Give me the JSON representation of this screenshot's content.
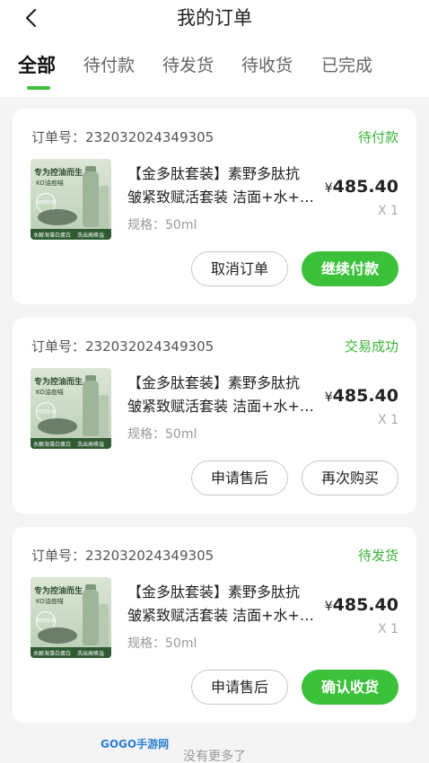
{
  "header": {
    "title": "我的订单",
    "back_icon": "chevron-left-icon"
  },
  "tabs": [
    {
      "label": "全部",
      "active": true
    },
    {
      "label": "待付款",
      "active": false
    },
    {
      "label": "待发货",
      "active": false
    },
    {
      "label": "待收货",
      "active": false
    },
    {
      "label": "已完成",
      "active": false
    }
  ],
  "accent_color": "#3cc13b",
  "product_image_text": {
    "headline": "专为控油而生",
    "sub": "KO油痘喵",
    "badge": "双效控油",
    "band_left": "水解海藻白蛋白",
    "band_right": "洗出高唤溢"
  },
  "orders": [
    {
      "order_label": "订单号：232032024349305",
      "status": "待付款",
      "product_line1": "【金多肽套装】素野多肽抗",
      "product_line2": "皱紧致赋活套装 洁面+水+…",
      "spec": "规格：50ml",
      "currency": "¥",
      "price": "485.40",
      "qty": "X 1",
      "buttons": [
        "取消订单",
        "继续付款"
      ]
    },
    {
      "order_label": "订单号：232032024349305",
      "status": "交易成功",
      "product_line1": "【金多肽套装】素野多肽抗",
      "product_line2": "皱紧致赋活套装 洁面+水+…",
      "spec": "规格：50ml",
      "currency": "¥",
      "price": "485.40",
      "qty": "X 1",
      "buttons": [
        "申请售后",
        "再次购买"
      ]
    },
    {
      "order_label": "订单号：232032024349305",
      "status": "待发货",
      "product_line1": "【金多肽套装】素野多肽抗",
      "product_line2": "皱紧致赋活套装 洁面+水+…",
      "spec": "规格：50ml",
      "currency": "¥",
      "price": "485.40",
      "qty": "X 1",
      "buttons": [
        "申请售后",
        "确认收货"
      ]
    }
  ],
  "footer": {
    "text": "没有更多了"
  },
  "watermark": "GOGO手游网"
}
